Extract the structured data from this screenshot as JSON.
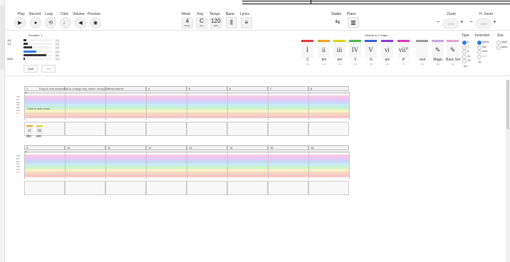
{
  "toolbar": {
    "play_label": "Play",
    "record_label": "Record",
    "loop_label": "Loop",
    "click_label": "Click",
    "volume_label": "Volume",
    "preview_label": "Preview",
    "meter_label": "Meter",
    "key_label": "Key",
    "tempo_label": "Tempo",
    "band_label": "Band",
    "lyrics_label": "Lyrics",
    "meter_value": "4",
    "meter_sub": "Beats",
    "key_value": "C",
    "key_sub": "Maj",
    "tempo_value": "120",
    "tempo_sub": "BPM",
    "stable_label": "Stable",
    "piano_label": "Piano",
    "zoom_label": "Zoom",
    "zoom_value": "100%",
    "hzoom_label": "H. Zoom",
    "hzoom_value": "100%",
    "minus": "−",
    "plus": "+"
  },
  "duration": {
    "title": "Duration: 1",
    "rows": [
      {
        "label": "1/4",
        "count": "(1)",
        "fill": 0.1
      },
      {
        "label": "1/2",
        "count": "(2)",
        "fill": 0.15
      },
      {
        "label": "",
        "count": "(Z)",
        "fill": 0.3
      },
      {
        "label": "",
        "count": "(3)",
        "fill": 0.45
      },
      {
        "label": "",
        "count": "(6)",
        "fill": 0.8
      },
      {
        "label": "ADD",
        "count": "(O)",
        "fill": 0.03
      }
    ],
    "split_label": "Split",
    "tie_label": "Tie"
  },
  "chords": {
    "header": "Chords in C major",
    "items": [
      {
        "roman": "I",
        "name": "C",
        "num": "(1)",
        "color": "#e03a3a"
      },
      {
        "roman": "ii",
        "name": "dm",
        "num": "(2)",
        "color": "#f0a020"
      },
      {
        "roman": "iii",
        "name": "em",
        "num": "(3)",
        "color": "#d4d41a"
      },
      {
        "roman": "IV",
        "name": "F",
        "num": "(4)",
        "color": "#4bb84b"
      },
      {
        "roman": "V",
        "name": "G",
        "num": "(5)",
        "color": "#3a62d8"
      },
      {
        "roman": "vi",
        "name": "am",
        "num": "(6)",
        "color": "#8a3ad8"
      },
      {
        "roman": "vii°",
        "name": "b°",
        "num": "(7)",
        "color": "#d83ab8"
      },
      {
        "roman": "",
        "name": "rest",
        "num": "(0)",
        "color": "#9a9a9a"
      },
      {
        "roman": "✎",
        "name": "Magic",
        "num": "(8)",
        "color": "#c9a4e0"
      },
      {
        "roman": "✎",
        "name": "Bass Set",
        "num": "(9)",
        "color": "#e0a4c9"
      }
    ]
  },
  "type": {
    "header": "Type",
    "options": [
      {
        "label": "5",
        "on": true
      },
      {
        "label": "7",
        "on": false
      },
      {
        "label": "9",
        "on": false
      },
      {
        "label": "11",
        "on": false
      },
      {
        "label": "13",
        "on": false
      }
    ],
    "extra": "(e)"
  },
  "inversion": {
    "header": "Inversion",
    "options": [
      {
        "label": "None",
        "on": true,
        "dim": false
      },
      {
        "label": "1st",
        "on": false,
        "dim": false
      },
      {
        "label": "2nd",
        "on": false,
        "dim": false
      },
      {
        "label": "3rd",
        "on": false,
        "dim": true
      }
    ],
    "extra": "(i)"
  },
  "sus": {
    "header": "Sus",
    "options": [
      {
        "label": "sus2",
        "on": false
      },
      {
        "label": "sus4",
        "on": false
      }
    ]
  },
  "editor": {
    "hint_top": "Drag to add measures, or change key, meter, tempo or instruments",
    "click_hint": "Click to add notes",
    "section1_measures": [
      "1",
      "2",
      "3",
      "4",
      "5",
      "6",
      "7",
      "8"
    ],
    "section2_measures": [
      "9",
      "10",
      "11",
      "12",
      "13",
      "14",
      "15",
      "16"
    ],
    "pitch_labels": [
      "7 B",
      "6 A",
      "5 G",
      "4 F",
      "3 E",
      "2 D",
      "1 C"
    ],
    "row_marker": "(E)",
    "chord_cards": [
      {
        "roman": "ii",
        "name": "dm",
        "color": "#f0a020"
      },
      {
        "roman": "iii",
        "name": "em",
        "color": "#d4d41a"
      }
    ]
  },
  "colors": {
    "bands": [
      "#f6c8e6",
      "#e3c8f6",
      "#c8d8f6",
      "#c8ecf2",
      "#cdf2cf",
      "#f4f4c4",
      "#f6d6c0",
      "#f6c6c6"
    ]
  }
}
